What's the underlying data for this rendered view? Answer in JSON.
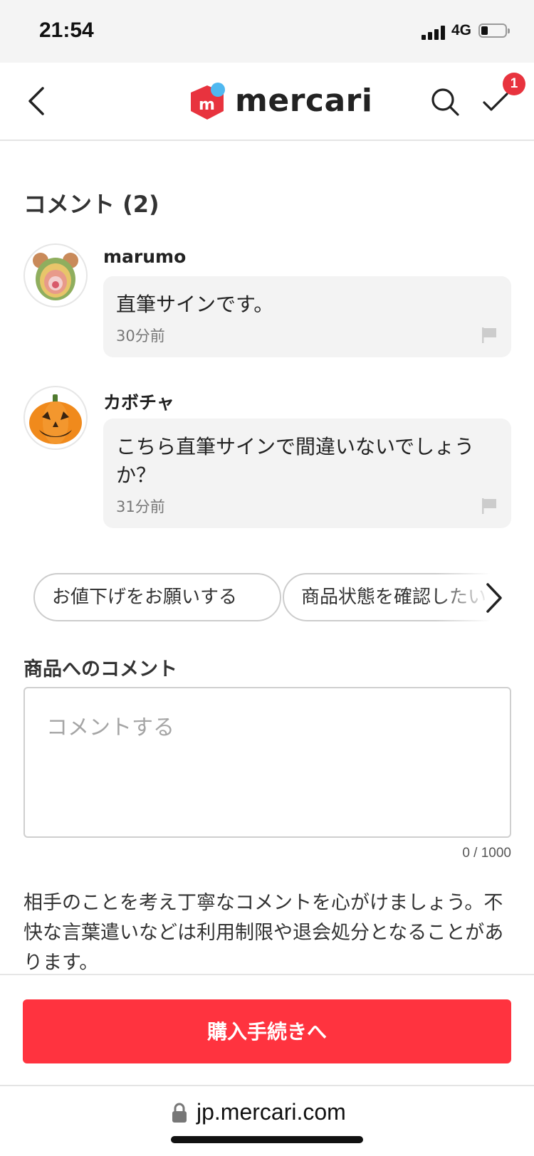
{
  "status_bar": {
    "time": "21:54",
    "network": "4G"
  },
  "nav": {
    "logo_text": "mercari",
    "badge_count": "1"
  },
  "comments": {
    "title": "コメント (2)",
    "items": [
      {
        "user": "marumo",
        "text": "直筆サインです。",
        "time": "30分前"
      },
      {
        "user": "カボチャ",
        "text": "こちら直筆サインで間違いないでしょうか？",
        "time": "31分前"
      }
    ]
  },
  "quick_replies": [
    "お値下げをお願いする",
    "商品状態を確認したい"
  ],
  "comment_form": {
    "label": "商品へのコメント",
    "placeholder": "コメントする",
    "value": "",
    "char_count": "0 / 1000"
  },
  "notice": "相手のことを考え丁寧なコメントを心がけましょう。不快な言葉遣いなどは利用制限や退会処分となることがあります。",
  "buy_button_label": "購入手続きへ",
  "browser": {
    "url": "jp.mercari.com"
  },
  "colors": {
    "accent": "#ff333f",
    "badge": "#e8333e",
    "logo_red": "#e8333e",
    "logo_blue": "#4fb8f0"
  }
}
